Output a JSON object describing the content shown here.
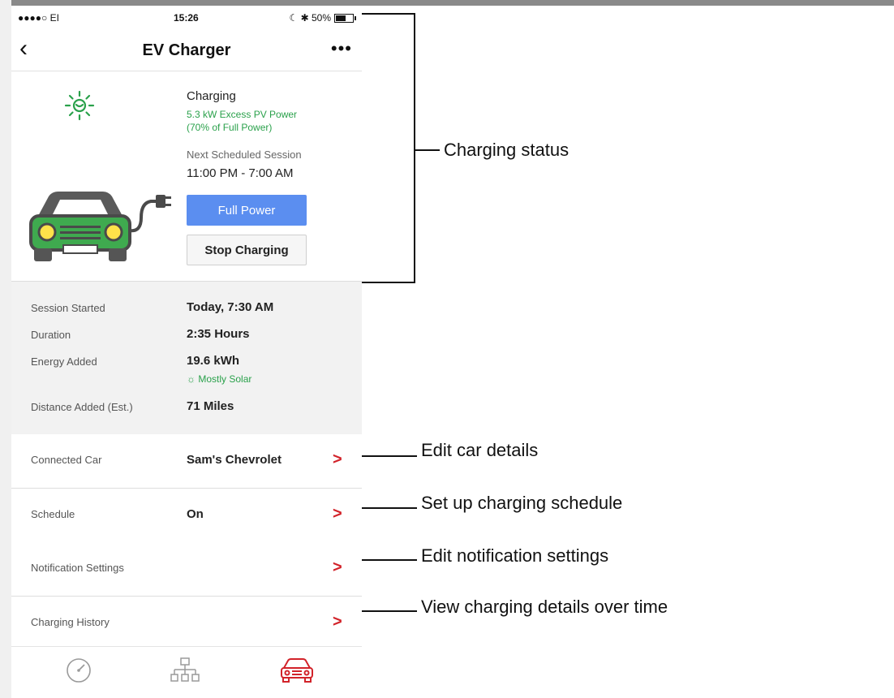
{
  "status_bar": {
    "signal": "●●●●○ EI",
    "time": "15:26",
    "right": "☾ ✱ 50%"
  },
  "nav": {
    "back_icon": "chevron-left-icon",
    "title": "EV Charger",
    "more_icon": "more-horizontal-icon"
  },
  "status": {
    "title": "Charging",
    "sub_line1": "5.3 kW Excess PV Power",
    "sub_line2": "(70% of Full Power)",
    "next_label": "Next Scheduled Session",
    "next_time": "11:00 PM - 7:00 AM",
    "full_power_label": "Full Power",
    "stop_label": "Stop Charging",
    "colors": {
      "green": "#2aa14b",
      "blue": "#5b8ef0",
      "red": "#d2232a"
    }
  },
  "session": {
    "started_label": "Session Started",
    "started_value": "Today, 7:30 AM",
    "duration_label": "Duration",
    "duration_value": "2:35 Hours",
    "energy_label": "Energy Added",
    "energy_value": "19.6 kWh",
    "solar_note": "Mostly Solar",
    "distance_label": "Distance Added  (Est.)",
    "distance_value": "71 Miles"
  },
  "rows": [
    {
      "label": "Connected Car",
      "value": "Sam's Chevrolet"
    },
    {
      "label": "Schedule",
      "value": "On"
    },
    {
      "label": "Notification Settings",
      "value": ""
    },
    {
      "label": "Charging History",
      "value": ""
    }
  ],
  "tabs": [
    {
      "icon": "gauge-icon"
    },
    {
      "icon": "network-icon"
    },
    {
      "icon": "car-icon",
      "active": true
    }
  ],
  "annotations": {
    "charging_status": "Charging status",
    "edit_car": "Edit car details",
    "schedule": "Set up charging schedule",
    "notifications": "Edit notification settings",
    "history": "View charging details over time"
  }
}
